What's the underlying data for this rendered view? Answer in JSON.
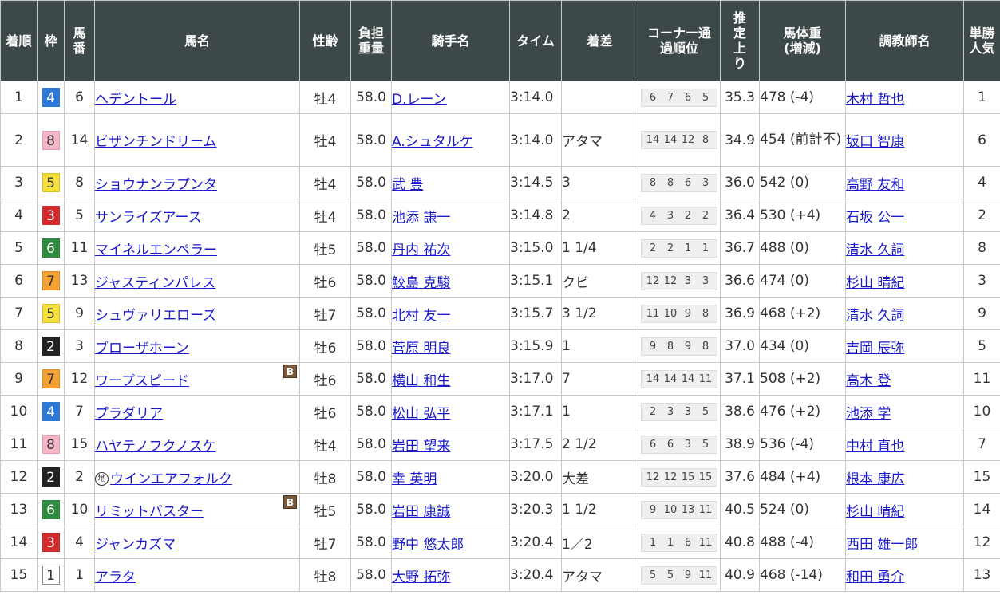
{
  "headers": {
    "rank": "着順",
    "waku": "枠",
    "umaban": "馬番",
    "horse": "馬名",
    "sex_age": "性齢",
    "weight_carried": "負担重量",
    "jockey": "騎手名",
    "time": "タイム",
    "margin": "着差",
    "corner": "コーナー通過順位",
    "last3f": "推定上り",
    "body_weight": "馬体重(増減)",
    "trainer": "調教師名",
    "popularity": "単勝人気"
  },
  "waku_colors": {
    "1": {
      "bg": "#ffffff",
      "fg": "#333333",
      "border": "#888888"
    },
    "2": {
      "bg": "#222222",
      "fg": "#ffffff",
      "border": "#222222"
    },
    "3": {
      "bg": "#d32b2b",
      "fg": "#ffffff",
      "border": "#d32b2b"
    },
    "4": {
      "bg": "#2b78d6",
      "fg": "#ffffff",
      "border": "#2b78d6"
    },
    "5": {
      "bg": "#f7e03c",
      "fg": "#333333",
      "border": "#d8c020"
    },
    "6": {
      "bg": "#2e8b3e",
      "fg": "#ffffff",
      "border": "#2e8b3e"
    },
    "7": {
      "bg": "#f5a234",
      "fg": "#333333",
      "border": "#e08a1a"
    },
    "8": {
      "bg": "#f6b6c8",
      "fg": "#333333",
      "border": "#e89ab0"
    }
  },
  "icons": {
    "blinker": "B",
    "local": "地"
  },
  "rows": [
    {
      "rank": "1",
      "waku": "4",
      "umaban": "6",
      "horse": "ヘデントール",
      "sex_age": "牡4",
      "weight": "58.0",
      "jockey": "D.レーン",
      "time": "3:14.0",
      "margin": "",
      "corners": [
        "6",
        "7",
        "6",
        "5"
      ],
      "last3f": "35.3",
      "body_weight": "478 (-4)",
      "trainer": "木村 哲也",
      "pop": "1"
    },
    {
      "rank": "2",
      "waku": "8",
      "umaban": "14",
      "horse": "ビザンチンドリーム",
      "sex_age": "牡4",
      "weight": "58.0",
      "jockey": "A.シュタルケ",
      "time": "3:14.0",
      "margin": "アタマ",
      "corners": [
        "14",
        "14",
        "12",
        "8"
      ],
      "last3f": "34.9",
      "body_weight": "454 (前計不)",
      "trainer": "坂口 智康",
      "pop": "6"
    },
    {
      "rank": "3",
      "waku": "5",
      "umaban": "8",
      "horse": "ショウナンラプンタ",
      "sex_age": "牡4",
      "weight": "58.0",
      "jockey": "武 豊",
      "time": "3:14.5",
      "margin": "3",
      "corners": [
        "8",
        "8",
        "6",
        "3"
      ],
      "last3f": "36.0",
      "body_weight": "542 (0)",
      "trainer": "高野 友和",
      "pop": "4"
    },
    {
      "rank": "4",
      "waku": "3",
      "umaban": "5",
      "horse": "サンライズアース",
      "sex_age": "牡4",
      "weight": "58.0",
      "jockey": "池添 謙一",
      "time": "3:14.8",
      "margin": "2",
      "corners": [
        "4",
        "3",
        "2",
        "2"
      ],
      "last3f": "36.4",
      "body_weight": "530 (+4)",
      "trainer": "石坂 公一",
      "pop": "2"
    },
    {
      "rank": "5",
      "waku": "6",
      "umaban": "11",
      "horse": "マイネルエンペラー",
      "sex_age": "牡5",
      "weight": "58.0",
      "jockey": "丹内 祐次",
      "time": "3:15.0",
      "margin": "1 1/4",
      "corners": [
        "2",
        "2",
        "1",
        "1"
      ],
      "last3f": "36.7",
      "body_weight": "488 (0)",
      "trainer": "清水 久詞",
      "pop": "8"
    },
    {
      "rank": "6",
      "waku": "7",
      "umaban": "13",
      "horse": "ジャスティンパレス",
      "sex_age": "牡6",
      "weight": "58.0",
      "jockey": "鮫島 克駿",
      "time": "3:15.1",
      "margin": "クビ",
      "corners": [
        "12",
        "12",
        "3",
        "3"
      ],
      "last3f": "36.6",
      "body_weight": "474 (0)",
      "trainer": "杉山 晴紀",
      "pop": "3"
    },
    {
      "rank": "7",
      "waku": "5",
      "umaban": "9",
      "horse": "シュヴァリエローズ",
      "sex_age": "牡7",
      "weight": "58.0",
      "jockey": "北村 友一",
      "time": "3:15.7",
      "margin": "3 1/2",
      "corners": [
        "11",
        "10",
        "9",
        "8"
      ],
      "last3f": "36.9",
      "body_weight": "468 (+2)",
      "trainer": "清水 久詞",
      "pop": "9"
    },
    {
      "rank": "8",
      "waku": "2",
      "umaban": "3",
      "horse": "ブローザホーン",
      "sex_age": "牡6",
      "weight": "58.0",
      "jockey": "菅原 明良",
      "time": "3:15.9",
      "margin": "1",
      "corners": [
        "9",
        "8",
        "9",
        "8"
      ],
      "last3f": "37.0",
      "body_weight": "434 (0)",
      "trainer": "吉岡 辰弥",
      "pop": "5"
    },
    {
      "rank": "9",
      "waku": "7",
      "umaban": "12",
      "horse": "ワープスピード",
      "blinker": true,
      "sex_age": "牡6",
      "weight": "58.0",
      "jockey": "横山 和生",
      "time": "3:17.0",
      "margin": "7",
      "corners": [
        "14",
        "14",
        "14",
        "11"
      ],
      "last3f": "37.1",
      "body_weight": "508 (+2)",
      "trainer": "高木 登",
      "pop": "11"
    },
    {
      "rank": "10",
      "waku": "4",
      "umaban": "7",
      "horse": "プラダリア",
      "sex_age": "牡6",
      "weight": "58.0",
      "jockey": "松山 弘平",
      "time": "3:17.1",
      "margin": "1",
      "corners": [
        "2",
        "3",
        "3",
        "5"
      ],
      "last3f": "38.6",
      "body_weight": "476 (+2)",
      "trainer": "池添 学",
      "pop": "10"
    },
    {
      "rank": "11",
      "waku": "8",
      "umaban": "15",
      "horse": "ハヤテノフクノスケ",
      "sex_age": "牡4",
      "weight": "58.0",
      "jockey": "岩田 望来",
      "time": "3:17.5",
      "margin": "2 1/2",
      "corners": [
        "6",
        "6",
        "3",
        "5"
      ],
      "last3f": "38.9",
      "body_weight": "536 (-4)",
      "trainer": "中村 直也",
      "pop": "7"
    },
    {
      "rank": "12",
      "waku": "2",
      "umaban": "2",
      "horse": "ウインエアフォルク",
      "local": true,
      "sex_age": "牡8",
      "weight": "58.0",
      "jockey": "幸 英明",
      "time": "3:20.0",
      "margin": "大差",
      "corners": [
        "12",
        "12",
        "15",
        "15"
      ],
      "last3f": "37.6",
      "body_weight": "484 (+4)",
      "trainer": "根本 康広",
      "pop": "15"
    },
    {
      "rank": "13",
      "waku": "6",
      "umaban": "10",
      "horse": "リミットバスター",
      "blinker": true,
      "sex_age": "牡5",
      "weight": "58.0",
      "jockey": "岩田 康誠",
      "time": "3:20.3",
      "margin": "1 1/2",
      "corners": [
        "9",
        "10",
        "13",
        "11"
      ],
      "last3f": "40.5",
      "body_weight": "524 (0)",
      "trainer": "杉山 晴紀",
      "pop": "14"
    },
    {
      "rank": "14",
      "waku": "3",
      "umaban": "4",
      "horse": "ジャンカズマ",
      "sex_age": "牡7",
      "weight": "58.0",
      "jockey": "野中 悠太郎",
      "time": "3:20.4",
      "margin": "1／2",
      "corners": [
        "1",
        "1",
        "6",
        "11"
      ],
      "last3f": "40.8",
      "body_weight": "488 (-4)",
      "trainer": "西田 雄一郎",
      "pop": "12"
    },
    {
      "rank": "15",
      "waku": "1",
      "umaban": "1",
      "horse": "アラタ",
      "sex_age": "牡8",
      "weight": "58.0",
      "jockey": "大野 拓弥",
      "time": "3:20.4",
      "margin": "アタマ",
      "corners": [
        "5",
        "5",
        "9",
        "11"
      ],
      "last3f": "40.9",
      "body_weight": "468 (-14)",
      "trainer": "和田 勇介",
      "pop": "13"
    }
  ]
}
